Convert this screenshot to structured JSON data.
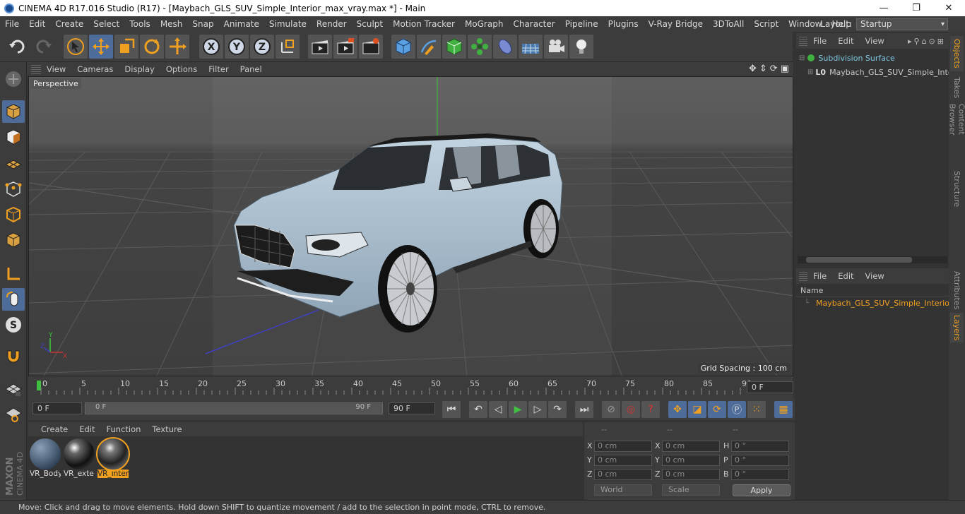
{
  "window": {
    "title": "CINEMA 4D R17.016 Studio (R17) - [Maybach_GLS_SUV_Simple_Interior_max_vray.max *] - Main",
    "minimize": "—",
    "maximize": "❐",
    "close": "✕"
  },
  "menubar": {
    "items": [
      "File",
      "Edit",
      "Create",
      "Select",
      "Tools",
      "Mesh",
      "Snap",
      "Animate",
      "Simulate",
      "Render",
      "Sculpt",
      "Motion Tracker",
      "MoGraph",
      "Character",
      "Pipeline",
      "Plugins",
      "V-Ray Bridge",
      "3DToAll",
      "Script",
      "Window",
      "Help"
    ],
    "layout_label": "Layout:",
    "layout_value": "Startup"
  },
  "viewport": {
    "menu": [
      "View",
      "Cameras",
      "Display",
      "Options",
      "Filter",
      "Panel"
    ],
    "camera_label": "Perspective",
    "grid_spacing": "Grid Spacing : 100 cm",
    "axis_y": "Y",
    "axis_x": "X",
    "axis_z": "Z"
  },
  "timeline": {
    "ticks": [
      "0",
      "5",
      "10",
      "15",
      "20",
      "25",
      "30",
      "35",
      "40",
      "45",
      "50",
      "55",
      "60",
      "65",
      "70",
      "75",
      "80",
      "85",
      "90"
    ],
    "current_frame": "0 F",
    "start_frame": "0 F",
    "range_start": "0 F",
    "range_end": "90 F",
    "end_frame": "90 F"
  },
  "materials": {
    "menu": [
      "Create",
      "Edit",
      "Function",
      "Texture"
    ],
    "items": [
      {
        "name": "VR_Body",
        "selected": false
      },
      {
        "name": "VR_exte",
        "selected": false
      },
      {
        "name": "VR_inter",
        "selected": true
      }
    ]
  },
  "coordinates": {
    "headers": [
      "--",
      "--",
      "--"
    ],
    "rows": [
      {
        "pos_label": "X",
        "pos": "0 cm",
        "size_label": "X",
        "size": "0 cm",
        "rot_label": "H",
        "rot": "0 °"
      },
      {
        "pos_label": "Y",
        "pos": "0 cm",
        "size_label": "Y",
        "size": "0 cm",
        "rot_label": "P",
        "rot": "0 °"
      },
      {
        "pos_label": "Z",
        "pos": "0 cm",
        "size_label": "Z",
        "size": "0 cm",
        "rot_label": "B",
        "rot": "0 °"
      }
    ],
    "mode_world": "World",
    "mode_scale": "Scale",
    "apply": "Apply"
  },
  "objects": {
    "menu": [
      "File",
      "Edit",
      "View"
    ],
    "tree": [
      {
        "name": "Subdivision Surface",
        "color": "#7ec8e3"
      },
      {
        "name": "Maybach_GLS_SUV_Simple_Interior",
        "color": "#c8c8c8"
      }
    ]
  },
  "layers": {
    "menu": [
      "File",
      "Edit",
      "View"
    ],
    "column": "Name",
    "items": [
      {
        "name": "Maybach_GLS_SUV_Simple_Interior",
        "color": "#e07020"
      }
    ]
  },
  "side_tabs": [
    "Objects",
    "Takes",
    "Content Browser",
    "Structure",
    "Attributes",
    "Layers"
  ],
  "brand": {
    "maxon": "MAXON",
    "cinema": "CINEMA 4D"
  },
  "status": "Move: Click and drag to move elements. Hold down SHIFT to quantize movement / add to the selection in point mode, CTRL to remove.",
  "colors": {
    "accent": "#4e6c9a",
    "highlight": "#f0a020",
    "car_body": "#a9bfcf"
  }
}
